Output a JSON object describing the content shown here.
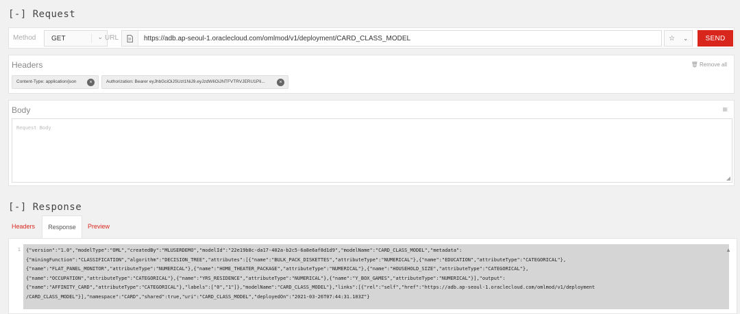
{
  "request": {
    "section_title": "[-] Request",
    "method_label": "Method",
    "method_value": "GET",
    "url_label": "URL",
    "url_value": "https://adb.ap-seoul-1.oraclecloud.com/omlmod/v1/deployment/CARD_CLASS_MODEL",
    "send_label": "SEND"
  },
  "headers": {
    "label": "Headers",
    "remove_all": "🗑 Remove all",
    "chips": [
      "Content-Type: application/json",
      "Authorization: Bearer eyJhbGciOiJSUzI1NiJ9.eyJzdWIiOiJNTFVTRVJERU1PIi..."
    ]
  },
  "body": {
    "label": "Body",
    "placeholder": "Request Body"
  },
  "response": {
    "section_title": "[-] Response",
    "tabs": [
      "Headers",
      "Response",
      "Preview"
    ],
    "line_number": "1",
    "lines": [
      "{\"version\":\"1.0\",\"modelType\":\"OML\",\"createdBy\":\"MLUSERDEMO\",\"modelId\":\"22e19b8c-da17-402a-b2c5-6a8e6af8d1d9\",\"modelName\":\"CARD_CLASS_MODEL\",\"metadata\":",
      "{\"miningFunction\":\"CLASSIFICATION\",\"algorithm\":\"DECISION_TREE\",\"attributes\":[{\"name\":\"BULK_PACK_DISKETTES\",\"attributeType\":\"NUMERICAL\"},{\"name\":\"EDUCATION\",\"attributeType\":\"CATEGORICAL\"},",
      "{\"name\":\"FLAT_PANEL_MONITOR\",\"attributeType\":\"NUMERICAL\"},{\"name\":\"HOME_THEATER_PACKAGE\",\"attributeType\":\"NUMERICAL\"},{\"name\":\"HOUSEHOLD_SIZE\",\"attributeType\":\"CATEGORICAL\"},",
      "{\"name\":\"OCCUPATION\",\"attributeType\":\"CATEGORICAL\"},{\"name\":\"YRS_RESIDENCE\",\"attributeType\":\"NUMERICAL\"},{\"name\":\"Y_BOX_GAMES\",\"attributeType\":\"NUMERICAL\"}],\"output\":",
      "{\"name\":\"AFFINITY_CARD\",\"attributeType\":\"CATEGORICAL\"},\"labels\":[\"0\",\"1\"]},\"modelName\":\"CARD_CLASS_MODEL\"},\"links\":[{\"rel\":\"self\",\"href\":\"https://adb.ap-seoul-1.oraclecloud.com/omlmod/v1/deployment",
      "/CARD_CLASS_MODEL\"}],\"namespace\":\"CARD\",\"shared\":true,\"uri\":\"CARD_CLASS_MODEL\",\"deployedOn\":\"2021-03-26T07:44:31.103Z\"}"
    ]
  }
}
